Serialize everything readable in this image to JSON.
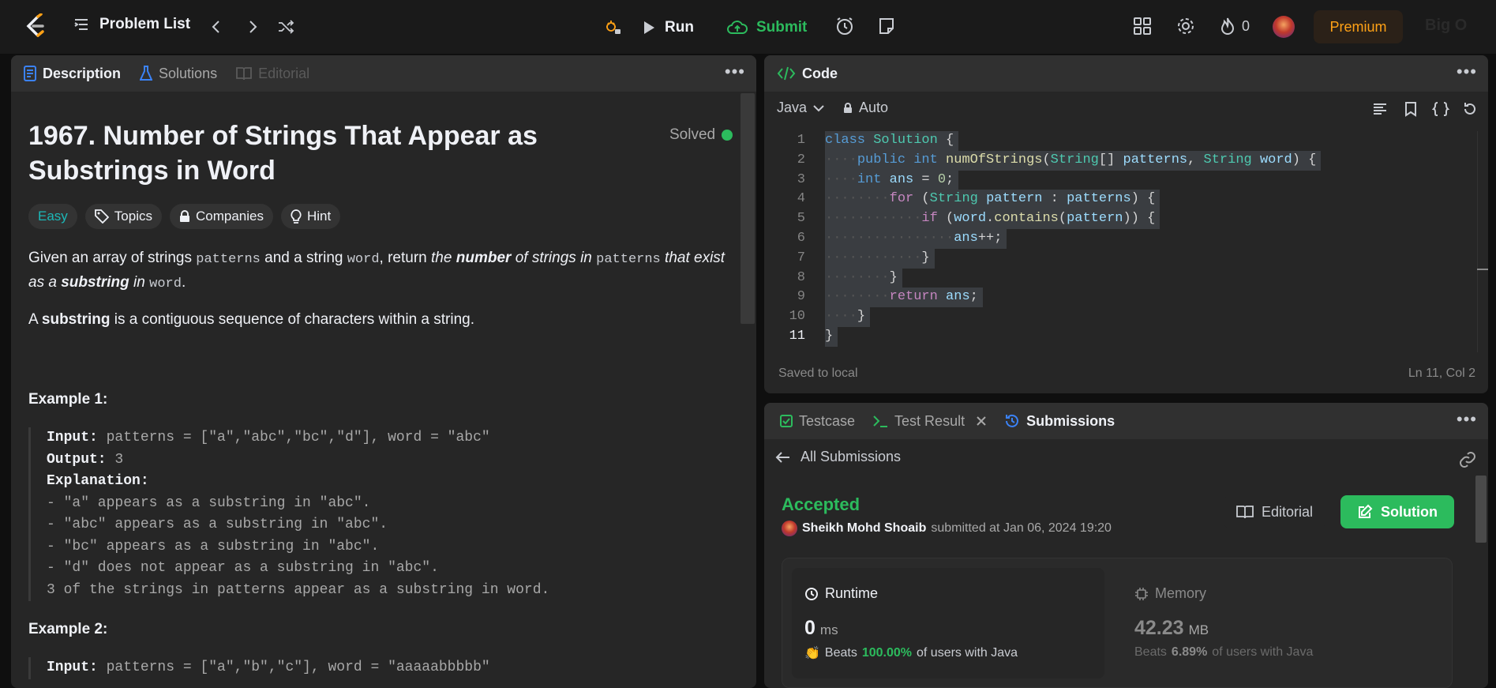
{
  "topbar": {
    "problem_list": "Problem List",
    "run": "Run",
    "submit": "Submit",
    "streak_count": "0",
    "premium": "Premium",
    "big_o": "Big O"
  },
  "description_panel": {
    "tabs": [
      {
        "label": "Description",
        "active": true
      },
      {
        "label": "Solutions",
        "active": false
      },
      {
        "label": "Editorial",
        "active": false
      }
    ],
    "title": "1967. Number of Strings That Appear as Substrings in Word",
    "status": "Solved",
    "tags": [
      "Easy",
      "Topics",
      "Companies",
      "Hint"
    ],
    "para1": {
      "t1": "Given an array of strings ",
      "c1": "patterns",
      "t2": " and a string ",
      "c2": "word",
      "t3": ", return ",
      "e1": "the ",
      "b1": "number",
      "e2": " of strings in ",
      "c3": "patterns",
      "e3": " that exist as a ",
      "b2": "substring",
      "e4": " in ",
      "c4": "word",
      "t4": "."
    },
    "para2": {
      "t1": "A ",
      "b1": "substring",
      "t2": " is a contiguous sequence of characters within a string."
    },
    "example1": {
      "title": "Example 1:",
      "input_label": "Input:",
      "input": " patterns = [\"a\",\"abc\",\"bc\",\"d\"], word = \"abc\"",
      "output_label": "Output:",
      "output": " 3",
      "explanation_label": "Explanation:",
      "lines": [
        "- \"a\" appears as a substring in \"abc\".",
        "- \"abc\" appears as a substring in \"abc\".",
        "- \"bc\" appears as a substring in \"abc\".",
        "- \"d\" does not appear as a substring in \"abc\".",
        "3 of the strings in patterns appear as a substring in word."
      ]
    },
    "example2": {
      "title": "Example 2:",
      "input_label": "Input:",
      "input": " patterns = [\"a\",\"b\",\"c\"], word = \"aaaaabbbbb\""
    }
  },
  "code_panel": {
    "title": "Code",
    "language": "Java",
    "mode": "Auto",
    "saved": "Saved to local",
    "cursor": "Ln 11, Col 2"
  },
  "submissions_panel": {
    "tabs": [
      {
        "label": "Testcase"
      },
      {
        "label": "Test Result"
      },
      {
        "label": "Submissions"
      }
    ],
    "back": "All Submissions",
    "status": "Accepted",
    "user": "Sheikh Mohd Shoaib",
    "submitted": "submitted at Jan 06, 2024 19:20",
    "editorial": "Editorial",
    "solution": "Solution",
    "runtime": {
      "label": "Runtime",
      "value": "0",
      "unit": "ms",
      "beats_prefix": "Beats",
      "beats": "100.00%",
      "beats_suffix": "of users with Java"
    },
    "memory": {
      "label": "Memory",
      "value": "42.23",
      "unit": "MB",
      "beats_prefix": "Beats",
      "beats": "6.89%",
      "beats_suffix": "of users with Java"
    }
  },
  "colors": {
    "accent_green": "#2cbb5d",
    "premium_orange": "#ffa116",
    "easy_teal": "#1cb8b8"
  }
}
